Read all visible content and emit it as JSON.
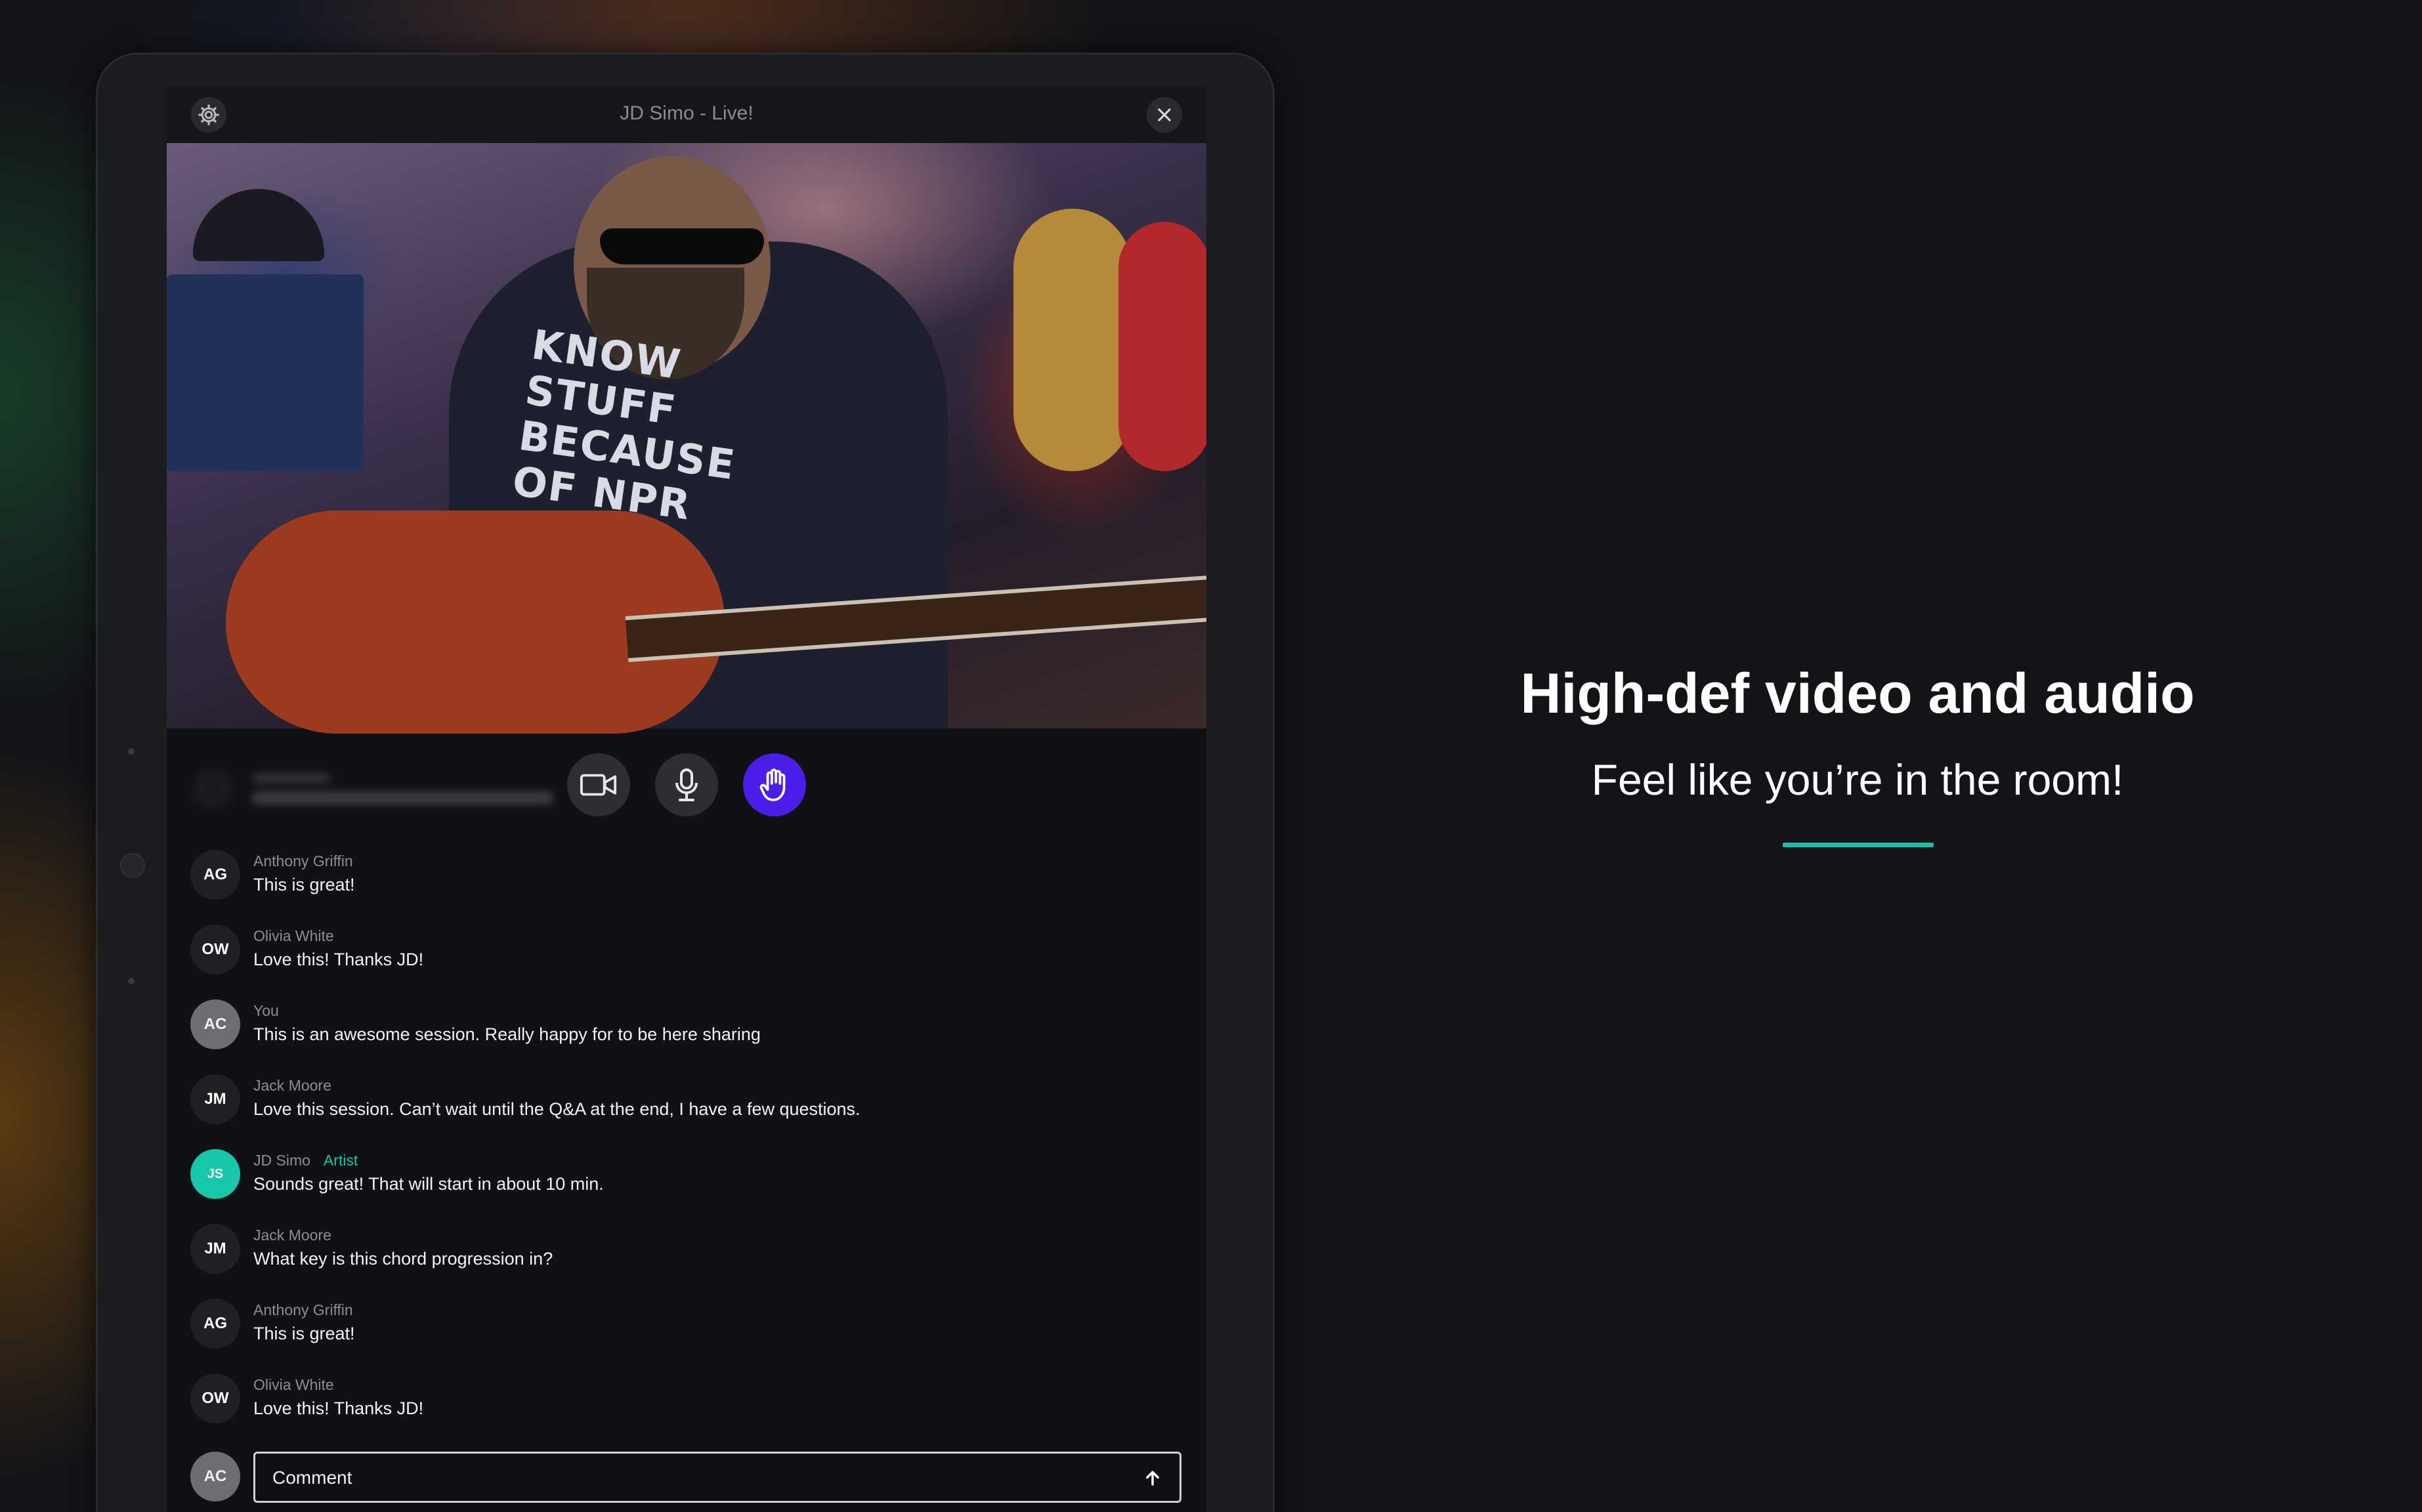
{
  "app": {
    "window_title": "JD Simo - Live!",
    "accent_color": "#16c7aa",
    "raise_hand_color": "#4a1ee6"
  },
  "toolbar": {
    "settings_icon": "gear-icon",
    "close_icon": "close-icon"
  },
  "controls": [
    {
      "name": "video-camera-icon",
      "active": false
    },
    {
      "name": "microphone-icon",
      "active": false
    },
    {
      "name": "raise-hand-icon",
      "active": true
    }
  ],
  "video": {
    "shirt_text": "KNOW STUFF BECAUSE OF NPR"
  },
  "chat": {
    "messages": [
      {
        "initials": "AG",
        "author": "Anthony Griffin",
        "text": "This is great!",
        "badge": ""
      },
      {
        "initials": "OW",
        "author": "Olivia White",
        "text": "Love this! Thanks JD!",
        "badge": ""
      },
      {
        "initials": "AC",
        "author": "You",
        "text": "This is an awesome session. Really happy for to be here sharing",
        "badge": ""
      },
      {
        "initials": "JM",
        "author": "Jack Moore",
        "text": "Love this session. Can’t wait until the Q&A at the end, I have a few questions.",
        "badge": ""
      },
      {
        "initials": "JS",
        "author": "JD Simo",
        "text": "Sounds great! That will start in about 10 min.",
        "badge": "Artist"
      },
      {
        "initials": "JM",
        "author": "Jack Moore",
        "text": "What key is this chord progression in?",
        "badge": ""
      },
      {
        "initials": "AG",
        "author": "Anthony Griffin",
        "text": "This is great!",
        "badge": ""
      },
      {
        "initials": "OW",
        "author": "Olivia White",
        "text": "Love this! Thanks JD!",
        "badge": ""
      }
    ]
  },
  "composer": {
    "avatar_initials": "AC",
    "placeholder": "Comment",
    "send_icon": "arrow-up-icon"
  },
  "promo": {
    "title": "High-def video and audio",
    "subtitle": "Feel like you’re in the room!"
  }
}
